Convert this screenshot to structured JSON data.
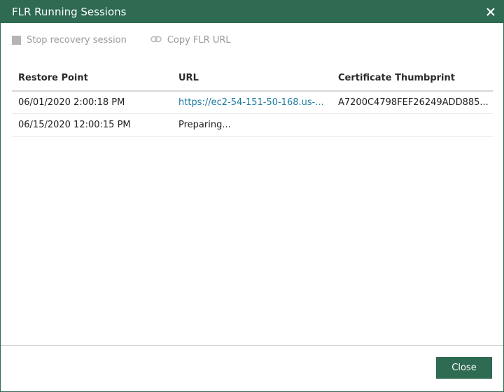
{
  "window": {
    "title": "FLR Running Sessions",
    "close_icon": "close-icon"
  },
  "toolbar": {
    "stop_label": "Stop recovery session",
    "copy_label": "Copy FLR URL"
  },
  "table": {
    "columns": [
      "Restore Point",
      "URL",
      "Certificate Thumbprint"
    ],
    "rows": [
      {
        "restore_point": "06/01/2020 2:00:18 PM",
        "url": "https://ec2-54-151-50-168.us-...",
        "thumbprint": "A7200C4798FEF26249ADD885..."
      },
      {
        "restore_point": "06/15/2020 12:00:15 PM",
        "url": "Preparing...",
        "thumbprint": ""
      }
    ]
  },
  "footer": {
    "close_label": "Close"
  },
  "colors": {
    "accent": "#2e6b52",
    "link": "#1f7ca3",
    "disabled": "#9a9a9a"
  }
}
